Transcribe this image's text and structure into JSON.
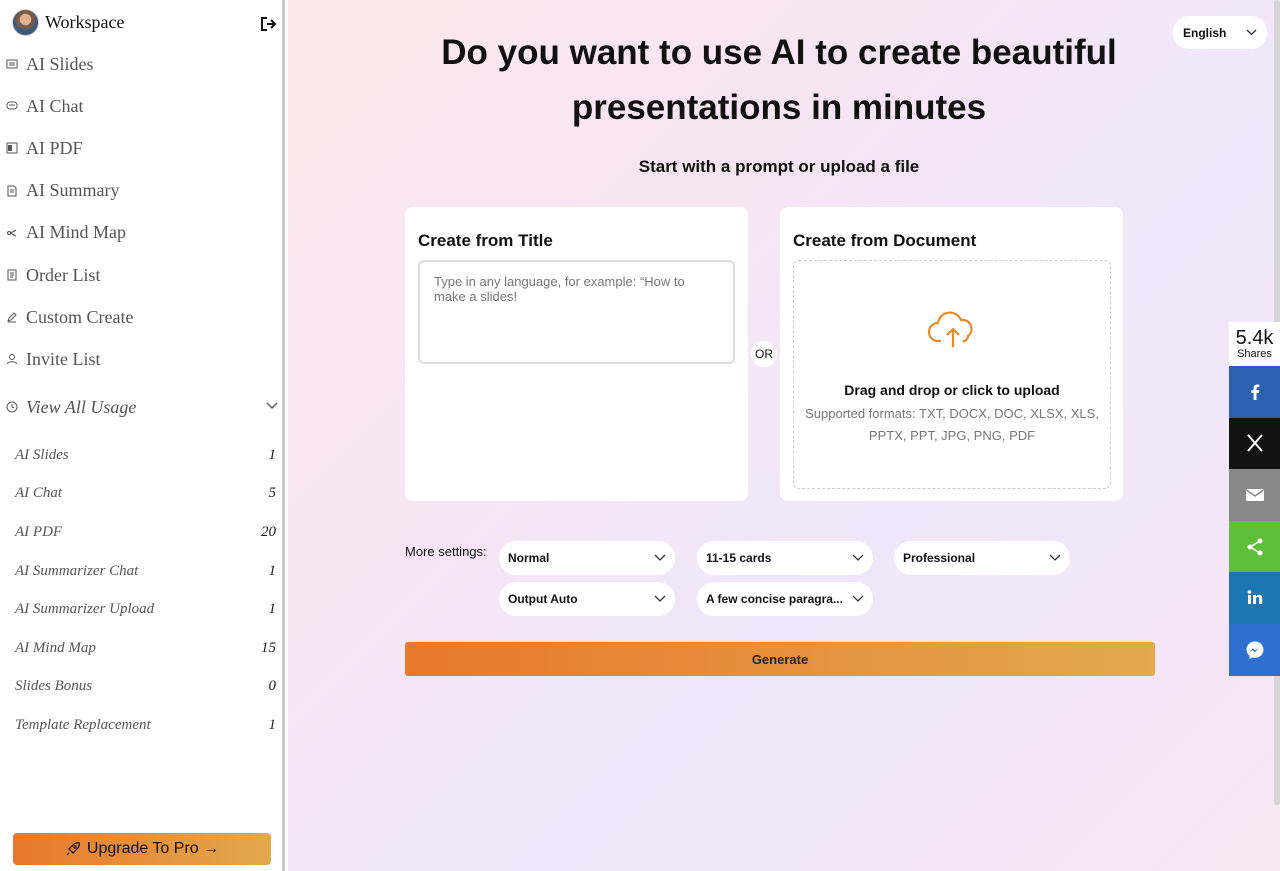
{
  "sidebar": {
    "workspace_title": "Workspace",
    "nav": [
      {
        "label": "AI Slides",
        "icon": "slides-icon"
      },
      {
        "label": "AI Chat",
        "icon": "chat-icon"
      },
      {
        "label": "AI PDF",
        "icon": "pdf-icon"
      },
      {
        "label": "AI Summary",
        "icon": "summary-icon"
      },
      {
        "label": "AI Mind Map",
        "icon": "mind-map-icon"
      },
      {
        "label": "Order List",
        "icon": "order-list-icon"
      },
      {
        "label": "Custom Create",
        "icon": "pencil-icon"
      },
      {
        "label": "Invite List",
        "icon": "user-icon"
      }
    ],
    "usage_title": "View All Usage",
    "usage": [
      {
        "label": "AI Slides",
        "value": "1"
      },
      {
        "label": "AI Chat",
        "value": "5"
      },
      {
        "label": "AI PDF",
        "value": "20"
      },
      {
        "label": "AI Summarizer Chat",
        "value": "1"
      },
      {
        "label": "AI Summarizer Upload",
        "value": "1"
      },
      {
        "label": "AI Mind Map",
        "value": "15"
      },
      {
        "label": "Slides Bonus",
        "value": "0"
      },
      {
        "label": "Template Replacement",
        "value": "1"
      }
    ],
    "upgrade_label": "Upgrade To Pro →"
  },
  "main": {
    "language": "English",
    "headline_line1": "Do you want to use AI to create beautiful",
    "headline_line2": "presentations in minutes",
    "subhead": "Start with a prompt or upload a file",
    "title_card": {
      "title": "Create from Title",
      "placeholder": "Type in any language, for example: “How to make a slides!"
    },
    "or_label": "OR",
    "doc_card": {
      "title": "Create from Document",
      "drop_title": "Drag and drop or click to upload",
      "formats": "Supported formats: TXT, DOCX, DOC, XLSX, XLS, PPTX, PPT, JPG, PNG, PDF"
    },
    "settings_label": "More settings:",
    "settings": {
      "tone": "Normal",
      "cards": "11-15 cards",
      "style": "Professional",
      "output": "Output Auto",
      "text_amount": "A few concise paragra..."
    },
    "generate_label": "Generate"
  },
  "share": {
    "count": "5.4k",
    "count_label": "Shares",
    "colors": {
      "facebook": "#2a62b0",
      "x": "#111111",
      "email": "#888888",
      "share": "#5fbf3b",
      "linkedin": "#1b76b3",
      "messenger": "#2e70d0"
    }
  }
}
